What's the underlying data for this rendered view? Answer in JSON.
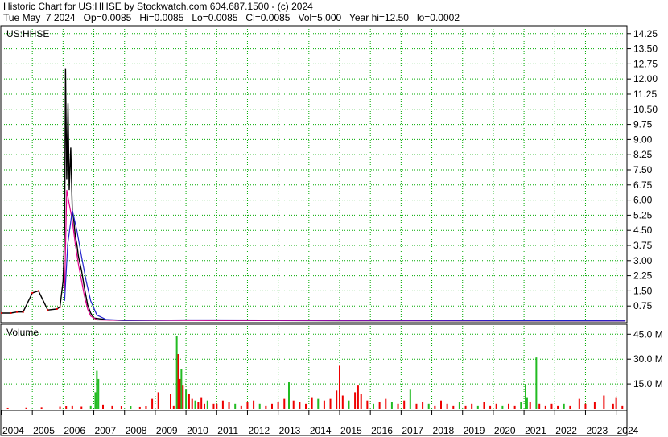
{
  "header": {
    "line1": "Historic Chart for US:HHSE by Stockwatch.com 604.687.1500 - (c) 2024",
    "line2": "Tue May  7 2024   Op=0.0085   Hi=0.0085   Lo=0.0085   Cl=0.0085   Vol=5,000   Year hi=12.50   lo=0.0002"
  },
  "colors": {
    "price": "#000000",
    "ma_short": "#e0008c",
    "ma_long": "#2222cc",
    "early_trades": "#ee0000",
    "volume_up": "#22bb22",
    "volume_down": "#ee0000",
    "grid": "#00aa00"
  },
  "chart_data": [
    {
      "type": "line",
      "title": "US:HHSE",
      "x": [
        "2004",
        "2005",
        "2006",
        "2007",
        "2008",
        "2009",
        "2010",
        "2011",
        "2012",
        "2013",
        "2014",
        "2015",
        "2016",
        "2017",
        "2018",
        "2019",
        "2020",
        "2021",
        "2022",
        "2023",
        "2024"
      ],
      "ylim": [
        0,
        14.6
      ],
      "yticks": [
        "0.75",
        "1.50",
        "2.25",
        "3.00",
        "3.75",
        "4.50",
        "5.25",
        "6.00",
        "6.75",
        "7.50",
        "8.25",
        "9.00",
        "9.75",
        "10.50",
        "11.25",
        "12.00",
        "12.75",
        "13.50",
        "14.25"
      ],
      "grid": true,
      "series": [
        {
          "values": [
            [
              2004.0,
              0.4
            ],
            [
              2004.3,
              0.4
            ],
            [
              2004.5,
              0.45
            ],
            [
              2004.7,
              0.45
            ],
            [
              2005.0,
              1.4
            ],
            [
              2005.2,
              1.5
            ],
            [
              2005.5,
              0.55
            ],
            [
              2005.8,
              0.6
            ],
            [
              2005.9,
              0.7
            ],
            [
              2006.0,
              2.0
            ],
            [
              2006.05,
              4.5
            ],
            [
              2006.08,
              12.5
            ],
            [
              2006.12,
              7.0
            ],
            [
              2006.16,
              10.8
            ],
            [
              2006.2,
              6.5
            ],
            [
              2006.25,
              8.6
            ],
            [
              2006.3,
              5.5
            ],
            [
              2006.35,
              5.0
            ],
            [
              2006.4,
              4.2
            ],
            [
              2006.45,
              3.8
            ],
            [
              2006.5,
              3.2
            ],
            [
              2006.6,
              2.5
            ],
            [
              2006.7,
              1.6
            ],
            [
              2006.8,
              0.8
            ],
            [
              2006.9,
              0.4
            ],
            [
              2007.0,
              0.15
            ],
            [
              2007.5,
              0.05
            ],
            [
              2008.0,
              0.03
            ],
            [
              2010.0,
              0.05
            ],
            [
              2011.0,
              0.04
            ],
            [
              2015.0,
              0.02
            ],
            [
              2020.0,
              0.01
            ],
            [
              2024.3,
              0.0085
            ]
          ]
        },
        {
          "values": [
            [
              2006.05,
              1.5
            ],
            [
              2006.12,
              6.5
            ],
            [
              2006.2,
              5.8
            ],
            [
              2006.3,
              5.0
            ],
            [
              2006.4,
              3.8
            ],
            [
              2006.5,
              2.8
            ],
            [
              2006.6,
              2.0
            ],
            [
              2006.7,
              1.2
            ],
            [
              2006.8,
              0.6
            ],
            [
              2006.9,
              0.25
            ],
            [
              2007.1,
              0.06
            ],
            [
              2008.0,
              0.03
            ],
            [
              2024.3,
              0.01
            ]
          ]
        },
        {
          "values": [
            [
              2006.05,
              1.0
            ],
            [
              2006.15,
              3.8
            ],
            [
              2006.3,
              5.5
            ],
            [
              2006.45,
              4.5
            ],
            [
              2006.6,
              3.2
            ],
            [
              2006.75,
              2.0
            ],
            [
              2006.9,
              1.0
            ],
            [
              2007.1,
              0.3
            ],
            [
              2007.4,
              0.08
            ],
            [
              2008.0,
              0.04
            ],
            [
              2010.0,
              0.06
            ],
            [
              2011.0,
              0.06
            ],
            [
              2024.3,
              0.01
            ]
          ]
        }
      ]
    },
    {
      "type": "bar",
      "title": "Volume",
      "yticks": [
        "15.0 M",
        "30.0 M",
        "45.0 M"
      ],
      "ylim": [
        0,
        50
      ],
      "grid": true,
      "bars": [
        [
          2004.2,
          0.5,
          0
        ],
        [
          2004.8,
          0.6,
          0
        ],
        [
          2005.3,
          0.8,
          0
        ],
        [
          2005.9,
          1.2,
          0
        ],
        [
          2006.1,
          1.8,
          0
        ],
        [
          2006.3,
          2.0,
          0
        ],
        [
          2006.6,
          1.2,
          0
        ],
        [
          2006.9,
          2.0,
          1
        ],
        [
          2007.05,
          10.0,
          1
        ],
        [
          2007.1,
          23.0,
          1
        ],
        [
          2007.15,
          18.0,
          1
        ],
        [
          2007.3,
          2.5,
          0
        ],
        [
          2007.6,
          2.0,
          0
        ],
        [
          2007.9,
          1.5,
          0
        ],
        [
          2008.2,
          1.8,
          1
        ],
        [
          2008.5,
          1.0,
          0
        ],
        [
          2008.7,
          1.5,
          0
        ],
        [
          2008.9,
          6.0,
          0
        ],
        [
          2009.1,
          10.0,
          0
        ],
        [
          2009.5,
          9.0,
          0
        ],
        [
          2009.6,
          2.0,
          0
        ],
        [
          2009.7,
          44.0,
          1
        ],
        [
          2009.75,
          33.0,
          0
        ],
        [
          2009.8,
          18.0,
          0
        ],
        [
          2009.85,
          24.0,
          1
        ],
        [
          2009.9,
          14.0,
          0
        ],
        [
          2010.0,
          12.0,
          1
        ],
        [
          2010.1,
          9.0,
          0
        ],
        [
          2010.2,
          6.0,
          0
        ],
        [
          2010.3,
          5.0,
          1
        ],
        [
          2010.4,
          4.0,
          0
        ],
        [
          2010.5,
          7.0,
          0
        ],
        [
          2010.6,
          3.0,
          0
        ],
        [
          2010.7,
          5.0,
          1
        ],
        [
          2010.9,
          3.0,
          0
        ],
        [
          2011.0,
          3.0,
          0
        ],
        [
          2011.2,
          5.0,
          0
        ],
        [
          2011.4,
          4.0,
          0
        ],
        [
          2011.6,
          3.0,
          1
        ],
        [
          2011.8,
          2.0,
          0
        ],
        [
          2012.0,
          4.0,
          0
        ],
        [
          2012.2,
          5.0,
          0
        ],
        [
          2012.4,
          3.0,
          1
        ],
        [
          2012.6,
          2.0,
          0
        ],
        [
          2012.8,
          3.0,
          0
        ],
        [
          2013.0,
          4.0,
          0
        ],
        [
          2013.2,
          6.0,
          0
        ],
        [
          2013.35,
          16.0,
          1
        ],
        [
          2013.5,
          5.0,
          0
        ],
        [
          2013.7,
          4.0,
          0
        ],
        [
          2013.9,
          3.0,
          0
        ],
        [
          2014.1,
          7.0,
          0
        ],
        [
          2014.3,
          6.0,
          1
        ],
        [
          2014.5,
          5.0,
          0
        ],
        [
          2014.7,
          6.0,
          0
        ],
        [
          2014.9,
          11.0,
          0
        ],
        [
          2015.0,
          26.0,
          0
        ],
        [
          2015.1,
          8.0,
          0
        ],
        [
          2015.3,
          5.0,
          1
        ],
        [
          2015.5,
          10.0,
          0
        ],
        [
          2015.6,
          14.0,
          0
        ],
        [
          2015.7,
          9.0,
          0
        ],
        [
          2015.9,
          5.0,
          0
        ],
        [
          2016.1,
          3.0,
          1
        ],
        [
          2016.3,
          4.0,
          0
        ],
        [
          2016.5,
          6.0,
          0
        ],
        [
          2016.7,
          4.0,
          1
        ],
        [
          2016.9,
          3.0,
          0
        ],
        [
          2017.1,
          5.0,
          0
        ],
        [
          2017.3,
          12.0,
          1
        ],
        [
          2017.5,
          3.0,
          0
        ],
        [
          2017.7,
          4.0,
          0
        ],
        [
          2017.9,
          3.0,
          1
        ],
        [
          2018.1,
          2.0,
          0
        ],
        [
          2018.3,
          5.0,
          0
        ],
        [
          2018.5,
          3.0,
          0
        ],
        [
          2018.7,
          2.0,
          0
        ],
        [
          2018.9,
          4.0,
          1
        ],
        [
          2019.1,
          2.0,
          0
        ],
        [
          2019.3,
          3.0,
          0
        ],
        [
          2019.5,
          2.0,
          1
        ],
        [
          2019.7,
          4.0,
          0
        ],
        [
          2019.9,
          2.0,
          0
        ],
        [
          2020.1,
          3.0,
          0
        ],
        [
          2020.3,
          2.0,
          1
        ],
        [
          2020.5,
          3.0,
          0
        ],
        [
          2020.7,
          2.0,
          0
        ],
        [
          2020.9,
          4.0,
          1
        ],
        [
          2021.05,
          15.0,
          1
        ],
        [
          2021.1,
          7.0,
          1
        ],
        [
          2021.2,
          4.0,
          0
        ],
        [
          2021.4,
          31.0,
          1
        ],
        [
          2021.5,
          3.0,
          0
        ],
        [
          2021.7,
          2.0,
          0
        ],
        [
          2021.9,
          3.0,
          0
        ],
        [
          2022.1,
          2.0,
          0
        ],
        [
          2022.3,
          3.0,
          1
        ],
        [
          2022.5,
          2.0,
          0
        ],
        [
          2022.8,
          6.0,
          0
        ],
        [
          2023.0,
          3.0,
          0
        ],
        [
          2023.3,
          4.0,
          0
        ],
        [
          2023.6,
          8.0,
          0
        ],
        [
          2023.9,
          3.0,
          0
        ],
        [
          2024.0,
          7.0,
          0
        ],
        [
          2024.2,
          2.0,
          0
        ]
      ]
    }
  ]
}
